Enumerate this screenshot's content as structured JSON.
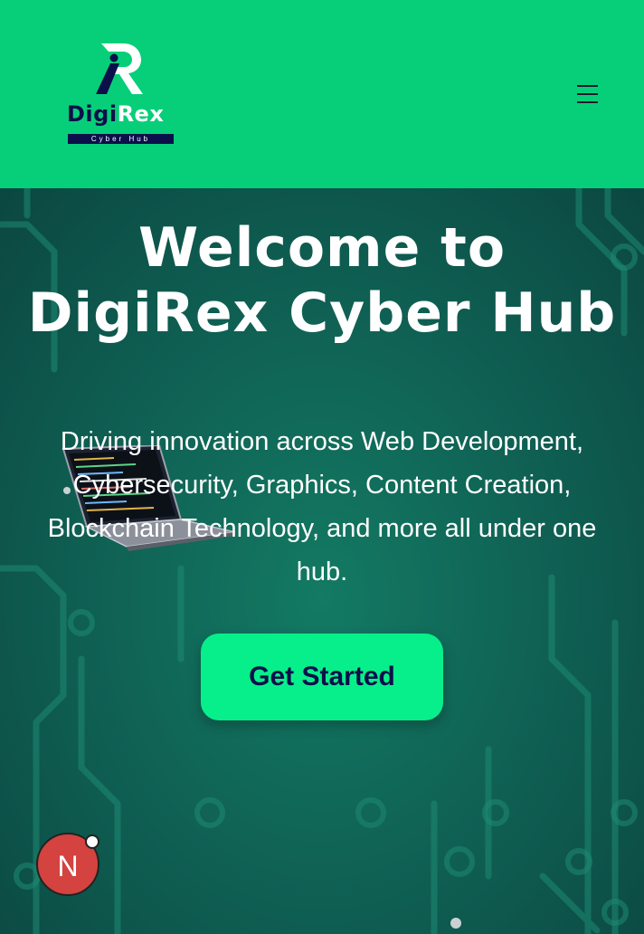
{
  "header": {
    "logo": {
      "word_dark": "Digi",
      "word_light": "Rex",
      "subtitle": "Cyber Hub",
      "colors": {
        "dark": "#0b0f4a",
        "light": "#ffffff"
      }
    },
    "menu_icon": "hamburger-menu-icon",
    "background": "#07cf79"
  },
  "hero": {
    "title_line1": "Welcome to",
    "title_line2": "DigiRex Cyber Hub",
    "description": "Driving innovation across Web Development, Cybersecurity, Graphics, Content Creation, Blockchain Technology, and more all under one hub.",
    "cta_label": "Get Started",
    "cta_color": "#07ef8a",
    "decorative_image": "laptop-with-code"
  },
  "notification_badge": {
    "label": "N",
    "color": "#d4433f"
  }
}
